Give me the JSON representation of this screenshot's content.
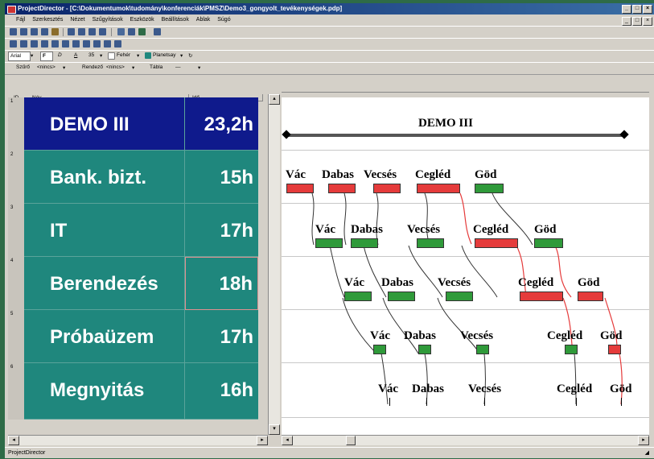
{
  "window": {
    "title": "ProjectDirector - [C:\\Dokumentumok\\tudomány\\konferenciák\\PMSZ\\Demo3_gongyolt_tevékenységek.pdp]",
    "status": "ProjectDirector"
  },
  "menu": [
    "Fájl",
    "Szerkesztés",
    "Nézet",
    "Szűgyítások",
    "Eszközök",
    "Beállítások",
    "Ablak",
    "Súgó"
  ],
  "format_toolbar": {
    "font": "Arial",
    "bold": "F",
    "italic": "D",
    "underline": "A",
    "size": "35",
    "text_color": "Fehér",
    "fill_color": "Planetsay"
  },
  "filter_toolbar": {
    "filter_label": "Szűrő",
    "filter_value": "<nincs>",
    "sort_label": "Rendező",
    "sort_value": "<nincs>",
    "table_label": "Tábla",
    "table_value": "—"
  },
  "columns": {
    "id": "ID",
    "name": "Név",
    "duration": "Idő"
  },
  "rows": [
    {
      "id": "1",
      "name": "DEMO III",
      "duration": "23,2h"
    },
    {
      "id": "2",
      "name": "Bank. bizt.",
      "duration": "15h"
    },
    {
      "id": "3",
      "name": "IT",
      "duration": "17h"
    },
    {
      "id": "4",
      "name": "Berendezés",
      "duration": "18h"
    },
    {
      "id": "5",
      "name": "Próbaüzem",
      "duration": "17h"
    },
    {
      "id": "6",
      "name": "Megnyitás",
      "duration": "16h"
    }
  ],
  "gantt": {
    "summary_label": "DEMO III",
    "label_vac": "Vác",
    "label_dabas": "Dabas",
    "label_vecses": "Vecsés",
    "label_cegled": "Cegléd",
    "label_god": "Göd"
  },
  "colors": {
    "row_summary_bg": "#0f1a8c",
    "row_task_bg": "#1f877d",
    "critical_bar": "#e53b3b",
    "normal_bar": "#2f9a3a"
  }
}
